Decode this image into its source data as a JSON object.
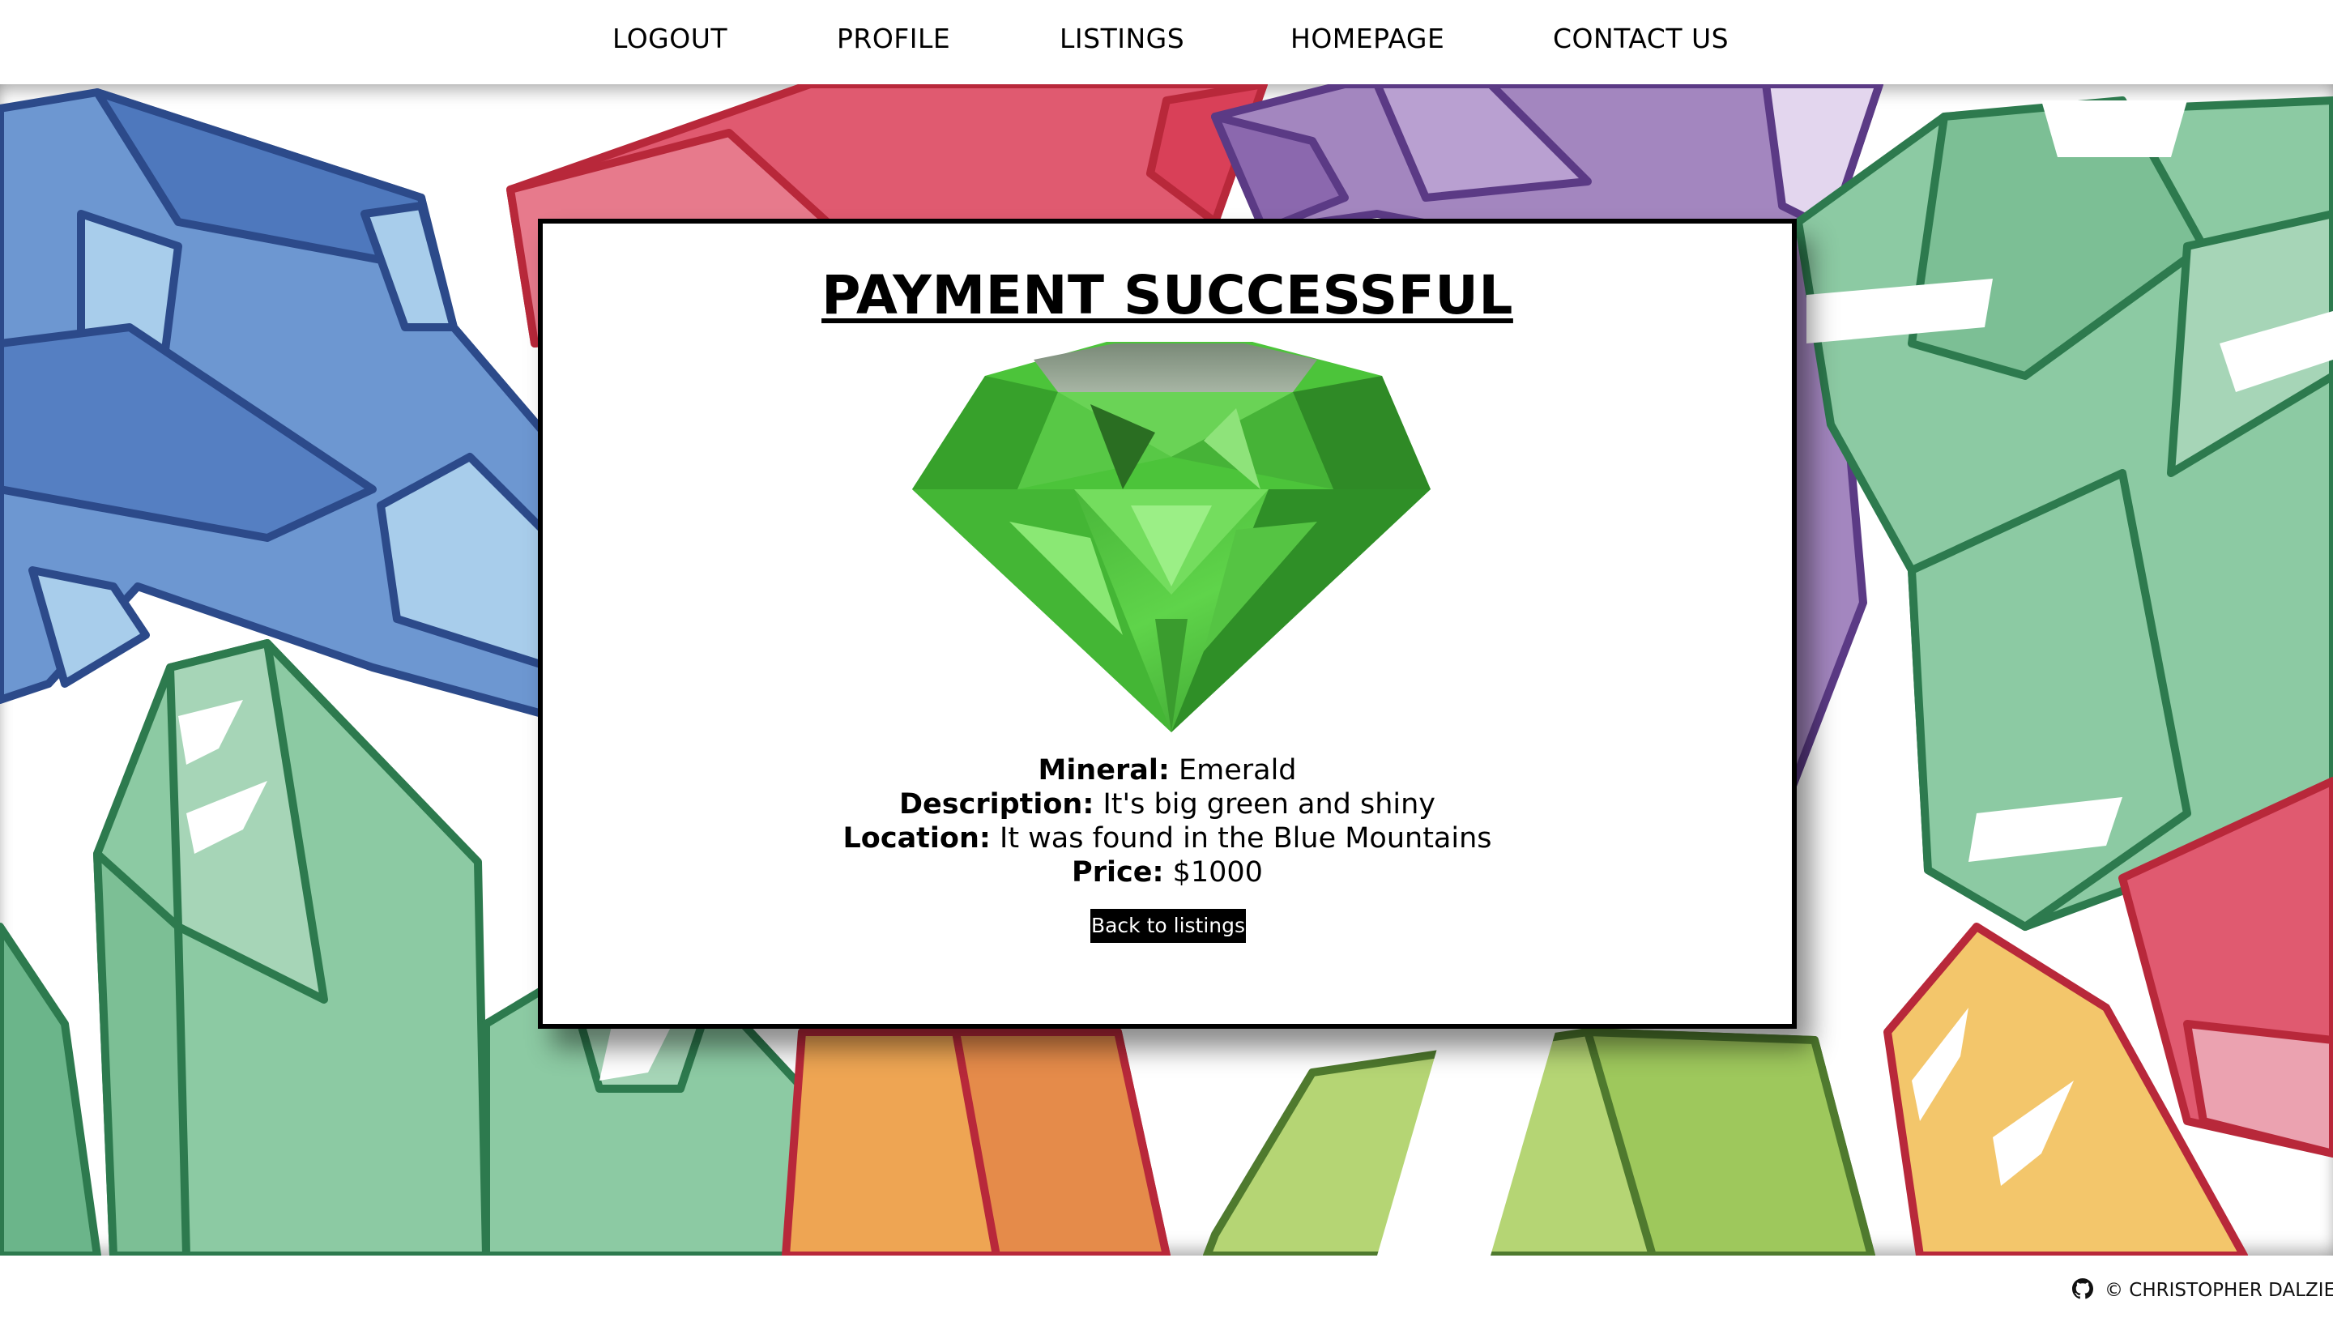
{
  "nav": {
    "items": [
      {
        "label": "LOGOUT"
      },
      {
        "label": "PROFILE"
      },
      {
        "label": "LISTINGS"
      },
      {
        "label": "HOMEPAGE"
      },
      {
        "label": "CONTACT US"
      }
    ]
  },
  "card": {
    "title": "PAYMENT SUCCESSFUL",
    "image_icon": "emerald-gem",
    "details": {
      "mineral_label": "Mineral:",
      "mineral_value": "Emerald",
      "description_label": "Description:",
      "description_value": "It's big green and shiny",
      "location_label": "Location:",
      "location_value": "It was found in the Blue Mountains",
      "price_label": "Price:",
      "price_value": "$1000"
    },
    "back_button": "Back to listings"
  },
  "footer": {
    "icon": "github-icon",
    "text": "© CHRISTOPHER DALZIEL"
  },
  "colors": {
    "crystal_blue": "#5c84c4",
    "crystal_red": "#e05a70",
    "crystal_purple": "#a386bf",
    "crystal_green": "#7cc39a",
    "crystal_orange": "#eea553",
    "crystal_yellow": "#f3c66b",
    "crystal_lime": "#b5d574",
    "emerald": "#4cc43a"
  }
}
